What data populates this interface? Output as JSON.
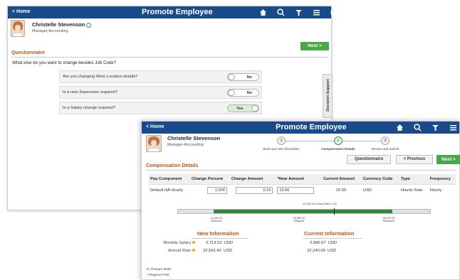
{
  "back_window": {
    "header": {
      "home": "< Home",
      "title": "Promote Employee"
    },
    "person": {
      "name": "Christelle Stevenson",
      "job": "Manager-Accounting"
    },
    "next_button": "Next >",
    "section_title": "Questionnaire",
    "question": "What else do you want to change besides Job Code?",
    "rows": [
      {
        "label": "Are you changing Work Location details?",
        "value": "No"
      },
      {
        "label": "Is a new Supervisor required?",
        "value": "No"
      },
      {
        "label": "Is a Salary change required?",
        "value": "Yes"
      }
    ],
    "decision_support": "Decision Support"
  },
  "front_window": {
    "header": {
      "home": "< Home",
      "title": "Promote Employee"
    },
    "person": {
      "name": "Christelle Stevenson",
      "job": "Manager-Accounting"
    },
    "steps": [
      {
        "num": "1",
        "label": "Work and Job Information"
      },
      {
        "num": "2",
        "label": "Compensation Details"
      },
      {
        "num": "3",
        "label": "Review and Submit"
      }
    ],
    "buttons": {
      "questionnaire": "Questionnaire",
      "previous": "< Previous",
      "next": "Next >"
    },
    "section_title": "Compensation Details",
    "table": {
      "headers": [
        "Pay Component",
        "Change Percent",
        "Change Amount",
        "*New Amount",
        "Current Amount",
        "Currency Code",
        "Type",
        "Frequency"
      ],
      "row": {
        "component": "Default NA Hourly",
        "change_percent": "1.000",
        "change_amount": "0.16",
        "new_amount": "15.66",
        "current_amount": "15.50",
        "currency": "USD",
        "type": "Hourly Rate",
        "frequency": "Hourly"
      }
    },
    "range": {
      "comp_ratio": "32,562.40 Comp-Ratio=1.05",
      "minimum_value": "24,463.00",
      "minimum_label": "Minimum",
      "midpoint_value": "30,583.00",
      "midpoint_label": "Midpoint",
      "maximum_value": "36,670.00",
      "maximum_label": "Maximum",
      "fill_start": 0.14,
      "fill_end": 0.85,
      "marker": 0.62
    },
    "new_info": {
      "title": "New Information",
      "monthly_label": "Monthly Salary",
      "monthly_value": "2,713.53",
      "monthly_currency": "USD",
      "annual_label": "Annual Rate",
      "annual_value": "32,562.40",
      "annual_currency": "USD"
    },
    "current_info": {
      "title": "Current Information",
      "monthly_value": "2,686.67",
      "monthly_currency": "USD",
      "annual_value": "32,240.00",
      "annual_currency": "USD"
    },
    "legend": {
      "changes": "Changes Made",
      "required": "* Required Field"
    }
  },
  "colors": {
    "header": "#194a8a",
    "accent_orange": "#b4581a",
    "green": "#48a84a",
    "range_fill": "#2d8a3c",
    "change_dot": "#f2a12b"
  }
}
